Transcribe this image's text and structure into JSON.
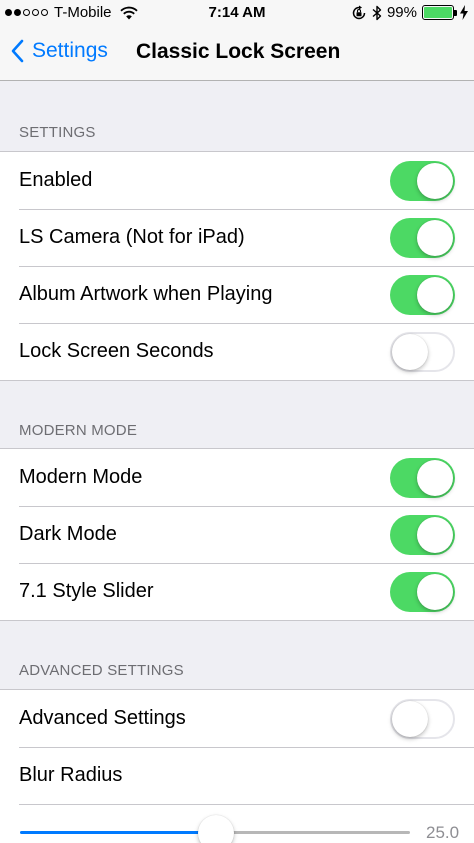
{
  "status_bar": {
    "carrier": "T-Mobile",
    "time": "7:14 AM",
    "battery_percent": "99%",
    "battery_level": 0.99,
    "signal_bars_filled": 2,
    "signal_bars_total": 5,
    "icons": [
      "wifi-icon",
      "orientation-lock-icon",
      "bluetooth-icon",
      "battery-icon",
      "charging-icon"
    ]
  },
  "nav": {
    "back_label": "Settings",
    "title": "Classic Lock Screen"
  },
  "colors": {
    "accent": "#007aff",
    "toggle_on": "#4cd964",
    "background": "#efeff4"
  },
  "sections": [
    {
      "header": "SETTINGS",
      "rows": [
        {
          "label": "Enabled",
          "on": true
        },
        {
          "label": "LS Camera (Not for iPad)",
          "on": true
        },
        {
          "label": "Album Artwork when Playing",
          "on": true
        },
        {
          "label": "Lock Screen Seconds",
          "on": false
        }
      ]
    },
    {
      "header": "MODERN MODE",
      "rows": [
        {
          "label": "Modern Mode",
          "on": true
        },
        {
          "label": "Dark Mode",
          "on": true
        },
        {
          "label": "7.1 Style Slider",
          "on": true
        }
      ]
    },
    {
      "header": "ADVANCED SETTINGS",
      "rows": [
        {
          "label": "Advanced Settings",
          "on": false
        },
        {
          "label": "Blur Radius"
        }
      ],
      "slider": {
        "value_label": "25.0",
        "fraction": 0.5
      }
    }
  ]
}
